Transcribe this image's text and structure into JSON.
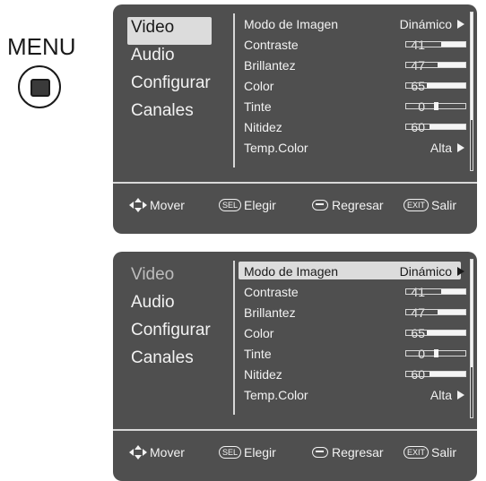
{
  "menu_button": {
    "label": "MENU",
    "icon": "menu-button-icon"
  },
  "panels": [
    {
      "left_menu": [
        {
          "label": "Video",
          "selected": true
        },
        {
          "label": "Audio"
        },
        {
          "label": "Configurar"
        },
        {
          "label": "Canales"
        }
      ],
      "rows": [
        {
          "label": "Modo de Imagen",
          "value": "Dinámico",
          "arrow": true
        },
        {
          "label": "Contraste",
          "value": "41",
          "bar": 0.41
        },
        {
          "label": "Brillantez",
          "value": "47",
          "bar": 0.47
        },
        {
          "label": "Color",
          "value": "65",
          "bar": 0.65
        },
        {
          "label": "Tinte",
          "value": "0",
          "bar": 0.5,
          "centered": true
        },
        {
          "label": "Nitidez",
          "value": "60",
          "bar": 0.6
        },
        {
          "label": "Temp.Color",
          "value": "Alta",
          "arrow": true
        }
      ]
    },
    {
      "left_menu": [
        {
          "label": "Video",
          "dim": true
        },
        {
          "label": "Audio"
        },
        {
          "label": "Configurar"
        },
        {
          "label": "Canales"
        }
      ],
      "rows": [
        {
          "label": "Modo de Imagen",
          "value": "Dinámico",
          "arrow": true,
          "selected": true
        },
        {
          "label": "Contraste",
          "value": "41",
          "bar": 0.41
        },
        {
          "label": "Brillantez",
          "value": "47",
          "bar": 0.47
        },
        {
          "label": "Color",
          "value": "65",
          "bar": 0.65
        },
        {
          "label": "Tinte",
          "value": "0",
          "bar": 0.5,
          "centered": true
        },
        {
          "label": "Nitidez",
          "value": "60",
          "bar": 0.6
        },
        {
          "label": "Temp.Color",
          "value": "Alta",
          "arrow": true
        }
      ]
    }
  ],
  "footer": {
    "move": "Mover",
    "sel_key": "SEL",
    "select": "Elegir",
    "back": "Regresar",
    "exit_key": "EXIT",
    "exit": "Salir"
  },
  "colors": {
    "panel_bg": "#4f4f4f",
    "highlight": "#dcdcdc",
    "text": "#f2f2f2"
  }
}
